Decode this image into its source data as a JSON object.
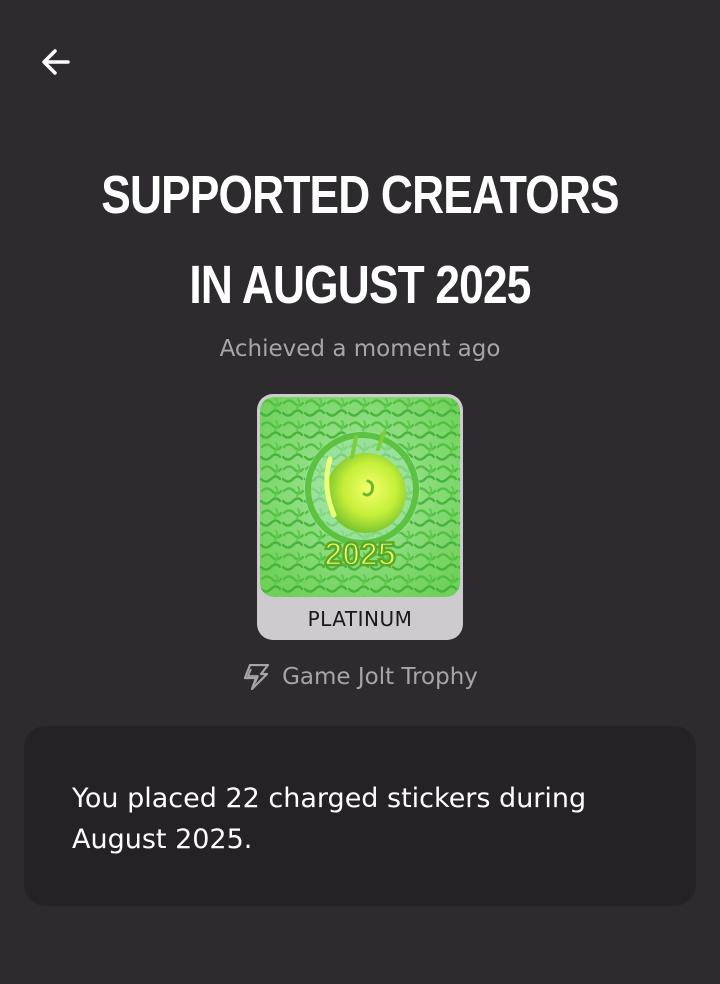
{
  "header": {
    "back_icon": "arrow-left-icon"
  },
  "trophy": {
    "title": "Supported Creators in August 2025",
    "achieved_text": "Achieved a moment ago",
    "badge_year": "2025",
    "tier_label": "PLATINUM",
    "type_icon": "game-jolt-icon",
    "type_label": "Game Jolt Trophy",
    "description": "You placed 22 charged stickers during August 2025."
  },
  "colors": {
    "background": "#2e2b2f",
    "card_background": "#252226",
    "badge_green": "#9be347",
    "muted_text": "#a8a4a9"
  }
}
